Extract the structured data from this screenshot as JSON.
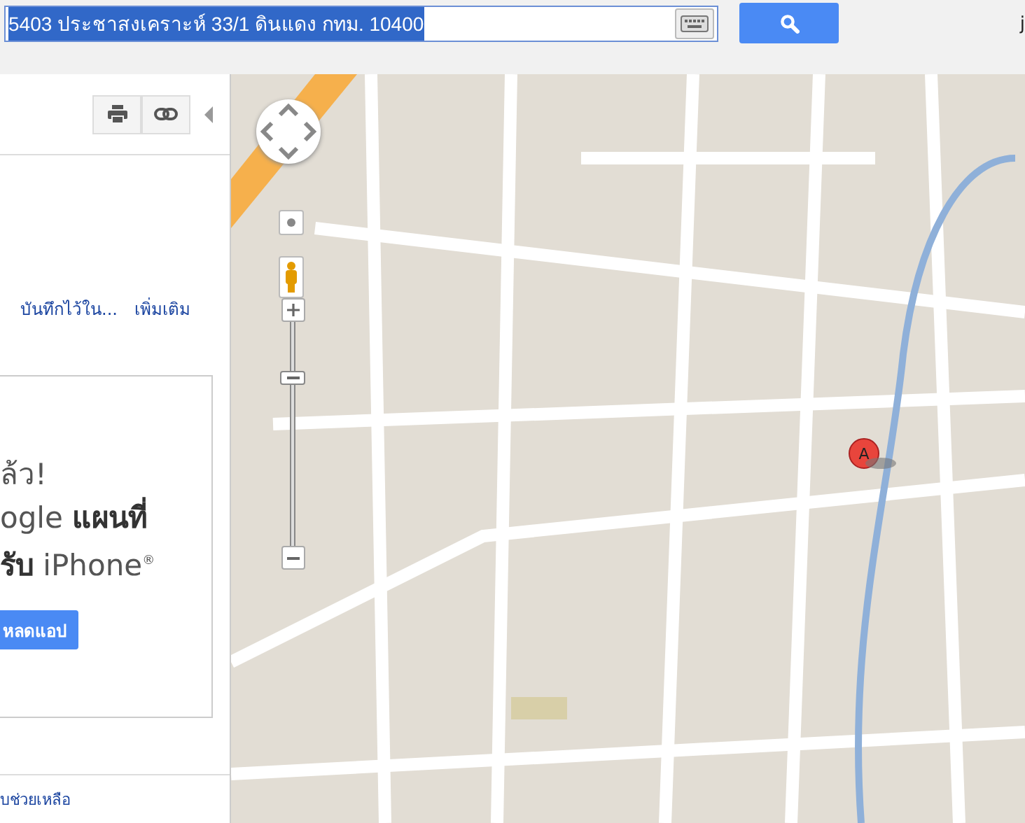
{
  "search": {
    "value": "5403  ประชาสงเคราะห์ 33/1 ดินแดง กทม. 10400",
    "selected": true
  },
  "header": {
    "cut_text": "j"
  },
  "panel": {
    "links": [
      "บันทึกไว้ใน...",
      "เพิ่มเติม"
    ],
    "promo": {
      "lines": [
        "ล้ว!",
        "ogle **แผนที่**",
        "**รับ** iPhone$^{®}$"
      ],
      "button": "หลดแอป"
    },
    "footer_link": "บช่วยเหลือ"
  },
  "map": {
    "zoom": {
      "level": 0.8
    },
    "marker": {
      "label": "A"
    }
  }
}
